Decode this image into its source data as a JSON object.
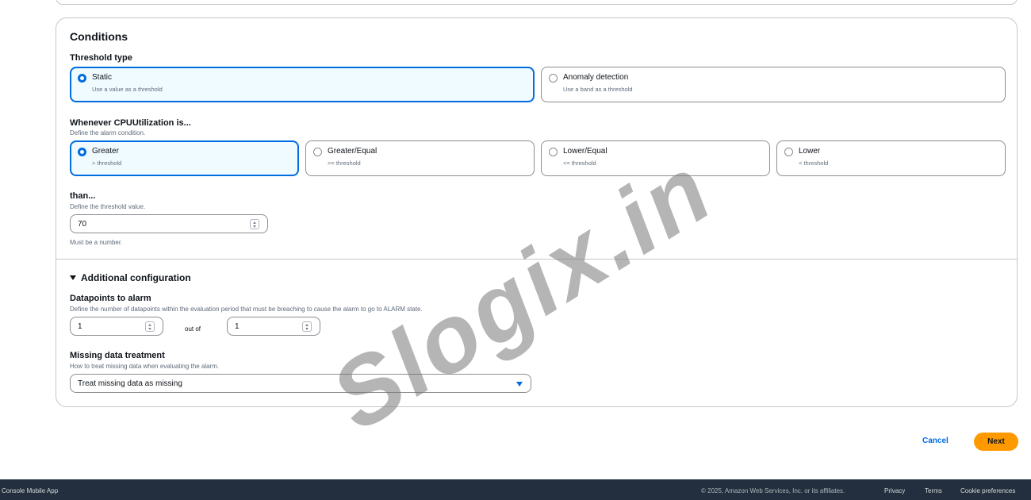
{
  "conditions": {
    "title": "Conditions",
    "threshold_type": {
      "label": "Threshold type",
      "options": [
        {
          "title": "Static",
          "sub": "Use a value as a threshold",
          "selected": true
        },
        {
          "title": "Anomaly detection",
          "sub": "Use a band as a threshold",
          "selected": false
        }
      ]
    },
    "whenever": {
      "label": "Whenever CPUUtilization is...",
      "desc": "Define the alarm condition.",
      "options": [
        {
          "title": "Greater",
          "sub": "> threshold",
          "selected": true
        },
        {
          "title": "Greater/Equal",
          "sub": ">= threshold",
          "selected": false
        },
        {
          "title": "Lower/Equal",
          "sub": "<= threshold",
          "selected": false
        },
        {
          "title": "Lower",
          "sub": "< threshold",
          "selected": false
        }
      ]
    },
    "than": {
      "label": "than...",
      "desc": "Define the threshold value.",
      "value": "70",
      "hint": "Must be a number."
    }
  },
  "additional": {
    "toggle_label": "Additional configuration",
    "datapoints": {
      "label": "Datapoints to alarm",
      "desc": "Define the number of datapoints within the evaluation period that must be breaching to cause the alarm to go to ALARM state.",
      "value_a": "1",
      "out_of": "out of",
      "value_b": "1"
    },
    "missing": {
      "label": "Missing data treatment",
      "desc": "How to treat missing data when evaluating the alarm.",
      "value": "Treat missing data as missing"
    }
  },
  "actions": {
    "cancel": "Cancel",
    "next": "Next"
  },
  "footer": {
    "mobile_app": "Console Mobile App",
    "copyright": "© 2025, Amazon Web Services, Inc. or its affiliates.",
    "privacy": "Privacy",
    "terms": "Terms",
    "cookies": "Cookie preferences"
  },
  "watermark": "Slogix.in",
  "colors": {
    "accent": "#006ce0",
    "primary_button": "#ff9900",
    "footer_bg": "#232f3e"
  }
}
